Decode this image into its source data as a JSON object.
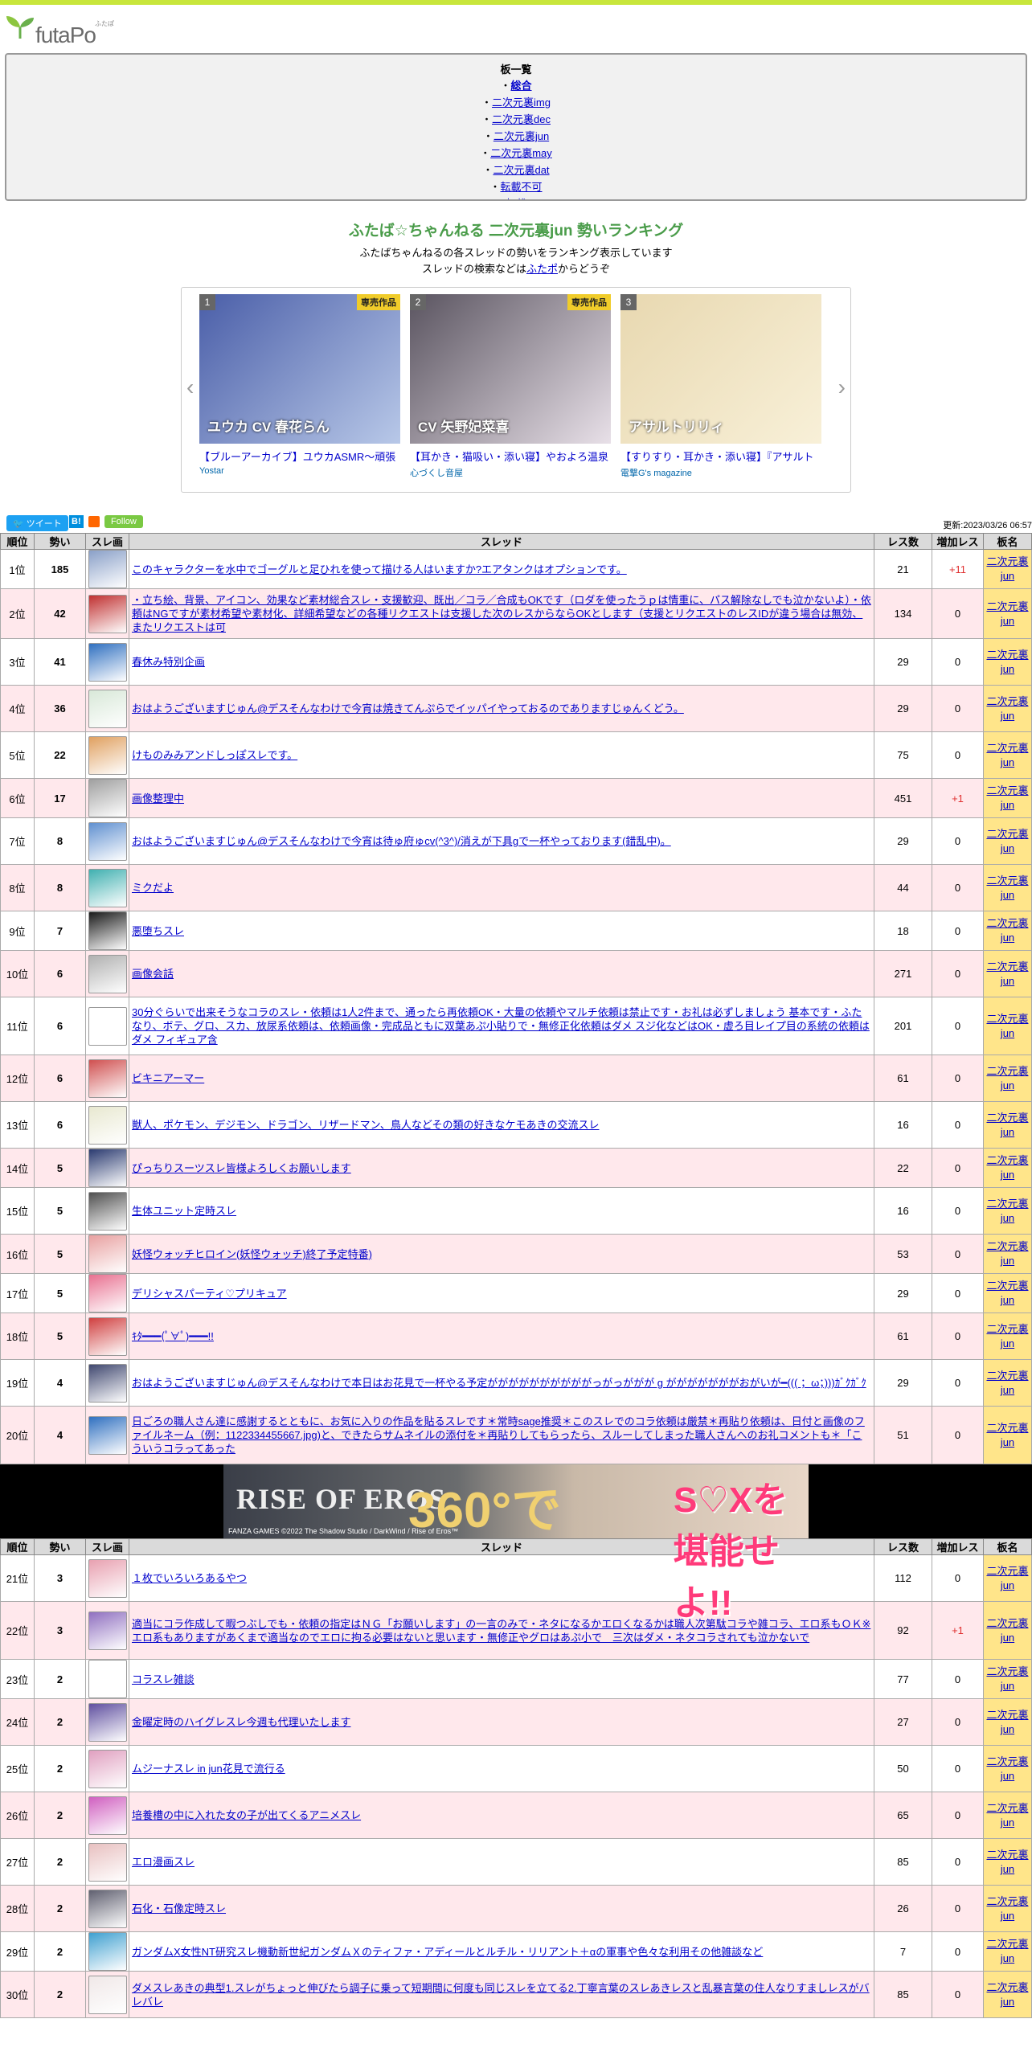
{
  "site": {
    "name": "futaPo",
    "ruby": "ふたぽ"
  },
  "boards": {
    "title": "板一覧",
    "items": [
      {
        "label": "総合",
        "bold": true
      },
      {
        "label": "二次元裏img",
        "bold": false
      },
      {
        "label": "二次元裏dec",
        "bold": false
      },
      {
        "label": "二次元裏jun",
        "bold": false
      },
      {
        "label": "二次元裏may",
        "bold": false
      },
      {
        "label": "二次元裏dat",
        "bold": false
      },
      {
        "label": "転載不可",
        "bold": false
      },
      {
        "label": "転載可",
        "bold": false
      }
    ],
    "bullet": "・"
  },
  "heading": {
    "title": "ふたば☆ちゃんねる 二次元裏jun 勢いランキング",
    "sub1": "ふたばちゃんねるの各スレッドの勢いをランキング表示しています",
    "sub2_pre": "スレッドの検索などは",
    "sub2_link": "ふたポ",
    "sub2_post": "からどうぞ"
  },
  "carousel": [
    {
      "num": "1",
      "tag": "専売作品",
      "overlay": "ユウカ CV 春花らん",
      "title": "【ブルーアーカイブ】ユウカASMR～頑張",
      "maker": "Yostar",
      "colors": [
        "#4a5ea8",
        "#b8c8e8"
      ]
    },
    {
      "num": "2",
      "tag": "専売作品",
      "overlay": "CV 矢野妃菜喜",
      "title": "【耳かき・猫吸い・添い寝】やおよろ温泉",
      "maker": "心づくし音屋",
      "colors": [
        "#5a5460",
        "#e8e0e8"
      ]
    },
    {
      "num": "3",
      "tag": "",
      "overlay": "アサルトリリィ",
      "title": "【すりすり・耳かき・添い寝】『アサルト",
      "maker": "電撃G's magazine",
      "colors": [
        "#e8d8b0",
        "#f8f0d8"
      ]
    }
  ],
  "share": {
    "tweet": "ツイート",
    "hatena": "B!",
    "follow": "Follow",
    "updated": "更新:2023/03/26 06:57"
  },
  "columns": [
    "順位",
    "勢い",
    "スレ画",
    "スレッド",
    "レス数",
    "増加レス",
    "板名"
  ],
  "board_name": [
    "二次元裏",
    "jun"
  ],
  "rows_a": [
    {
      "rank": "1位",
      "mom": "185",
      "title": "このキャラクターを水中でゴーグルと足ひれを使って描ける人はいますか?エアタンクはオプションです。",
      "res": "21",
      "inc": "+11",
      "h": 44,
      "c": "#8aa0c8"
    },
    {
      "rank": "2位",
      "mom": "42",
      "title": "・立ち絵、背景、アイコン、効果など素材総合スレ・支援歓迎、既出／コラ／合成もOKです（ロダを使ったうｐは情重に、パス解除なしでも泣かないよ）・依頼はNGですが素材希望や素材化、詳細希望などの各種リクエストは支援した次のレスからならOKとします（支援とリクエストのレスIDが違う場合は無効、またリクエストは可",
      "res": "134",
      "inc": "0",
      "h": 62,
      "c": "#c03030"
    },
    {
      "rank": "3位",
      "mom": "41",
      "title": "春休み特別企画",
      "res": "29",
      "inc": "0",
      "h": 58,
      "c": "#3070c0"
    },
    {
      "rank": "4位",
      "mom": "36",
      "title": "おはようございますじゅん@デスそんなわけで今宵は焼きてんぷらでイッパイやっておるのでありますじゅんくどう。",
      "res": "29",
      "inc": "0",
      "h": 58,
      "c": "#d8e8d8"
    },
    {
      "rank": "5位",
      "mom": "22",
      "title": "けものみみアンドしっぽスレです。",
      "res": "75",
      "inc": "0",
      "h": 58,
      "c": "#e0a060"
    },
    {
      "rank": "6位",
      "mom": "17",
      "title": "画像整理中",
      "res": "451",
      "inc": "+1",
      "h": 40,
      "c": "#a0a0a0"
    },
    {
      "rank": "7位",
      "mom": "8",
      "title": "おはようございますじゅん@デスそんなわけで今宵は待ゅ府ゅcv(^3^)/消えが下具gで一杯やっております(錯乱中)。",
      "res": "29",
      "inc": "0",
      "h": 58,
      "c": "#6090d0"
    },
    {
      "rank": "8位",
      "mom": "8",
      "title": "ミクだよ",
      "res": "44",
      "inc": "0",
      "h": 58,
      "c": "#40b0b0"
    },
    {
      "rank": "9位",
      "mom": "7",
      "title": "悪堕ちスレ",
      "res": "18",
      "inc": "0",
      "h": 44,
      "c": "#1a1a1a"
    },
    {
      "rank": "10位",
      "mom": "6",
      "title": "画像会話",
      "res": "271",
      "inc": "0",
      "h": 58,
      "c": "#b0b0b0"
    },
    {
      "rank": "11位",
      "mom": "6",
      "title": "30分ぐらいで出来そうなコラのスレ・依頼は1人2件まで、通ったら再依頼OK・大量の依頼やマルチ依頼は禁止です・お礼は必ずしましょう 基本です・ふたなり、ボテ、グロ、スカ、放尿系依頼は、依頼画像・完成品ともに双葉あぷ小貼りで・無修正化依頼はダメ スジ化などはOK・虚ろ目レイプ目の系統の依頼はダメ フィギュア含",
      "res": "201",
      "inc": "0",
      "h": 72,
      "c": "#ffffff"
    },
    {
      "rank": "12位",
      "mom": "6",
      "title": "ビキニアーマー",
      "res": "61",
      "inc": "0",
      "h": 58,
      "c": "#d05050"
    },
    {
      "rank": "13位",
      "mom": "6",
      "title": "獣人、ポケモン、デジモン、ドラゴン、リザードマン、鳥人などその類の好きなケモあきの交流スレ",
      "res": "16",
      "inc": "0",
      "h": 58,
      "c": "#e8e8d0"
    },
    {
      "rank": "14位",
      "mom": "5",
      "title": "ぴっちりスーツスレ皆様よろしくお願いします",
      "res": "22",
      "inc": "0",
      "h": 44,
      "c": "#2a3a70"
    },
    {
      "rank": "15位",
      "mom": "5",
      "title": "生体ユニット定時スレ",
      "res": "16",
      "inc": "0",
      "h": 58,
      "c": "#505050"
    },
    {
      "rank": "16位",
      "mom": "5",
      "title": "妖怪ウォッチヒロイン(妖怪ウォッチ)終了予定特番)",
      "res": "53",
      "inc": "0",
      "h": 40,
      "c": "#e8a0a0"
    },
    {
      "rank": "17位",
      "mom": "5",
      "title": "デリシャスパーティ♡プリキュア",
      "res": "29",
      "inc": "0",
      "h": 44,
      "c": "#e87090"
    },
    {
      "rank": "18位",
      "mom": "5",
      "title": "ｷﾀ━━━(ﾟ∀ﾟ)━━━!!",
      "res": "61",
      "inc": "0",
      "h": 58,
      "c": "#d04040"
    },
    {
      "rank": "19位",
      "mom": "4",
      "title": "おはようございますじゅん@デスそんなわけで本日はお花見で一杯やる予定ががががががががががっがっががが g がががががががおがいが━((( ；ω；)))ｶﾞｸｶﾞｸ",
      "res": "29",
      "inc": "0",
      "h": 58,
      "c": "#404870"
    },
    {
      "rank": "20位",
      "mom": "4",
      "title": "日ごろの職人さん達に感謝するとともに、お気に入りの作品を貼るスレです＊常時sage推奨＊このスレでのコラ依頼は厳禁＊再貼り依頼は、日付と画像のファイルネーム（例：1122334455667.jpg)と、できたらサムネイルの添付を＊再貼りしてもらったら、スルーしてしまった職人さんへのお礼コメントも＊「こういうコラってあった",
      "res": "51",
      "inc": "0",
      "h": 72,
      "c": "#3070c0"
    }
  ],
  "banner": {
    "b1": "RISE OF EROS",
    "b2": "360°で",
    "b3": "S♡Xを堪能せよ!!",
    "b4": "FANZA GAMES ©2022 The Shadow Studio / DarkWind / Rise of Eros™"
  },
  "rows_b": [
    {
      "rank": "21位",
      "mom": "3",
      "title": "１枚でいろいろあるやつ",
      "res": "112",
      "inc": "0",
      "h": 58,
      "c": "#e8a0b0"
    },
    {
      "rank": "22位",
      "mom": "3",
      "title": "適当にコラ作成して暇つぶしでも・依頼の指定はＮＧ「お願いします」の一言のみで・ネタになるかエロくなるかは職人次第駄コラや雑コラ、エロ系もＯＫ※エロ系もありますがあくまで適当なのでエロに拘る必要はないと思います・無修正やグロはあぷ小で　三次はダメ・ネタコラされても泣かないで",
      "res": "92",
      "inc": "+1",
      "h": 72,
      "c": "#9070c0"
    },
    {
      "rank": "23位",
      "mom": "2",
      "title": "コラスレ雑談",
      "res": "77",
      "inc": "0",
      "h": 40,
      "c": "#ffffff"
    },
    {
      "rank": "24位",
      "mom": "2",
      "title": "金曜定時のハイグレスレ今週も代理いたします",
      "res": "27",
      "inc": "0",
      "h": 58,
      "c": "#6050a0"
    },
    {
      "rank": "25位",
      "mom": "2",
      "title": "ムジーナスレ in jun花見で流行る",
      "res": "50",
      "inc": "0",
      "h": 58,
      "c": "#e0a0c0"
    },
    {
      "rank": "26位",
      "mom": "2",
      "title": "培養槽の中に入れた女の子が出てくるアニメスレ",
      "res": "65",
      "inc": "0",
      "h": 58,
      "c": "#d060c0"
    },
    {
      "rank": "27位",
      "mom": "2",
      "title": "エロ漫画スレ",
      "res": "85",
      "inc": "0",
      "h": 58,
      "c": "#e8c0c0"
    },
    {
      "rank": "28位",
      "mom": "2",
      "title": "石化・石像定時スレ",
      "res": "26",
      "inc": "0",
      "h": 58,
      "c": "#606070"
    },
    {
      "rank": "29位",
      "mom": "2",
      "title": "ガンダムX女性NT研究スレ機動新世紀ガンダムＸのティファ・アディールとルチル・リリアント＋αの軍事や色々な利用その他雑談など",
      "res": "7",
      "inc": "0",
      "h": 44,
      "c": "#40a0d0"
    },
    {
      "rank": "30位",
      "mom": "2",
      "title": "ダメスレあきの典型1.スレがちょっと伸びたら調子に乗って短期間に何度も同じスレを立てる2.丁寧言葉のスレあきレスと乱暴言葉の住人なりすましレスがバレバレ",
      "res": "85",
      "inc": "0",
      "h": 58,
      "c": "#f0e8e8"
    }
  ]
}
